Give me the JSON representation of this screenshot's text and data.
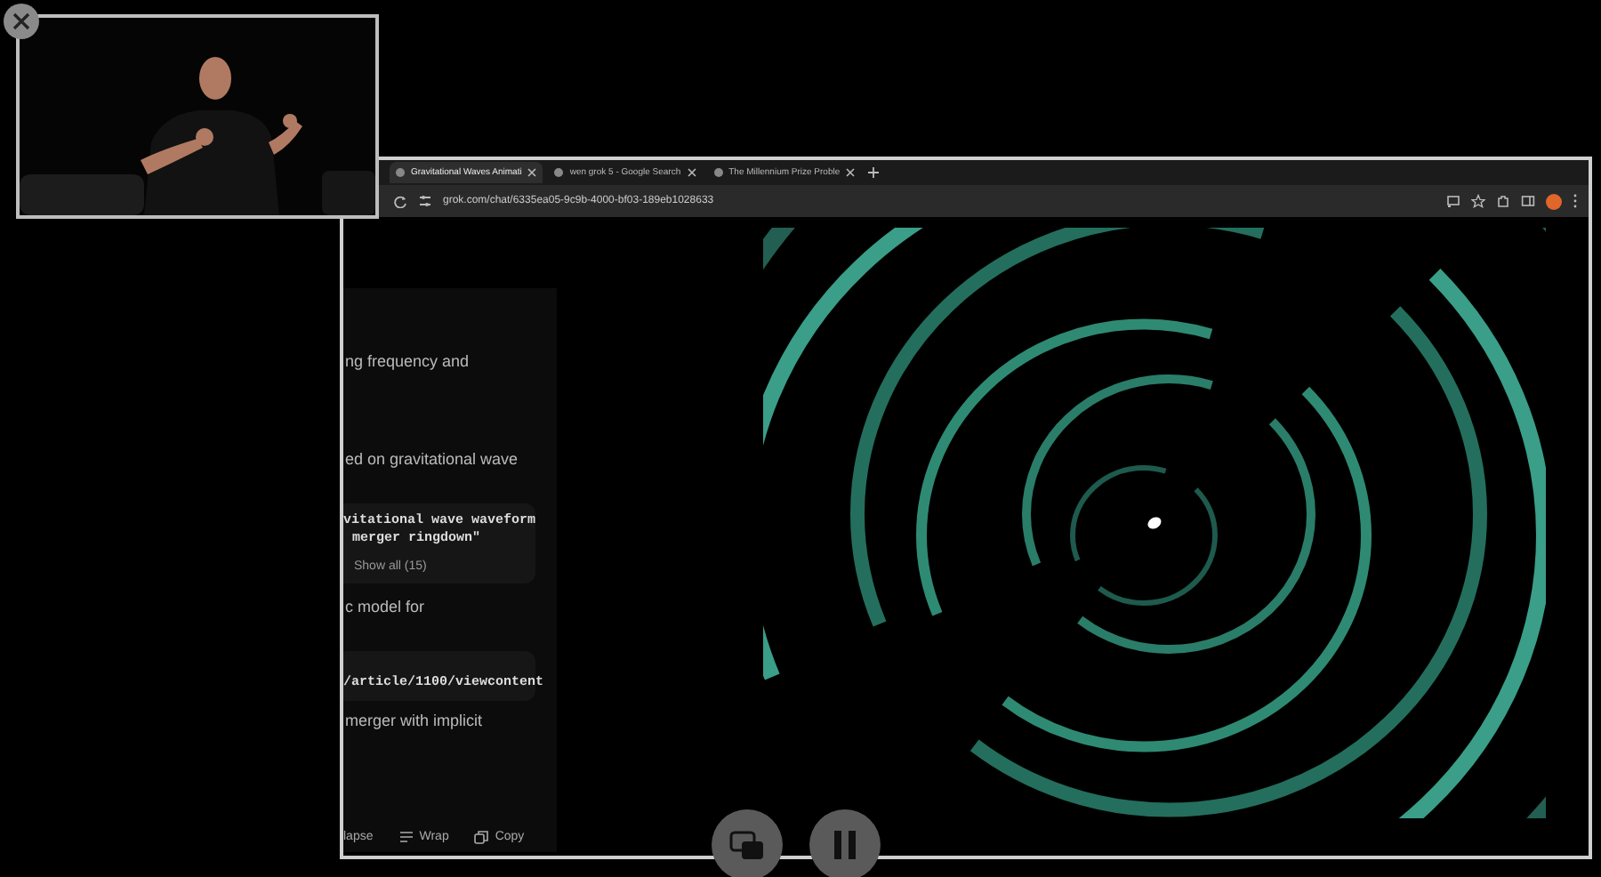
{
  "browser": {
    "tabs": [
      {
        "label": "Gravitational Waves Animati",
        "selected": true
      },
      {
        "label": "wen grok 5 - Google Search",
        "selected": false
      },
      {
        "label": "The Millennium Prize Proble",
        "selected": false
      }
    ],
    "url": "grok.com/chat/6335ea05-9c9b-4000-bf03-189eb1028633"
  },
  "chat": [
    {
      "kind": "text",
      "text": "ng frequency and"
    },
    {
      "kind": "text",
      "text": "ed on gravitational wave"
    },
    {
      "kind": "code",
      "lines": [
        "vitational wave waveform",
        "merger ringdown\""
      ],
      "button": "Show all (15)"
    },
    {
      "kind": "text",
      "text": "c model for"
    },
    {
      "kind": "code",
      "lines": [
        "/article/1100/viewcontent"
      ]
    },
    {
      "kind": "text",
      "text": "merger with implicit"
    }
  ],
  "code_toolbar": [
    {
      "kind": "plain",
      "label": "lapse"
    },
    {
      "kind": "wrap",
      "label": "Wrap"
    },
    {
      "kind": "copy",
      "label": "Copy"
    }
  ]
}
